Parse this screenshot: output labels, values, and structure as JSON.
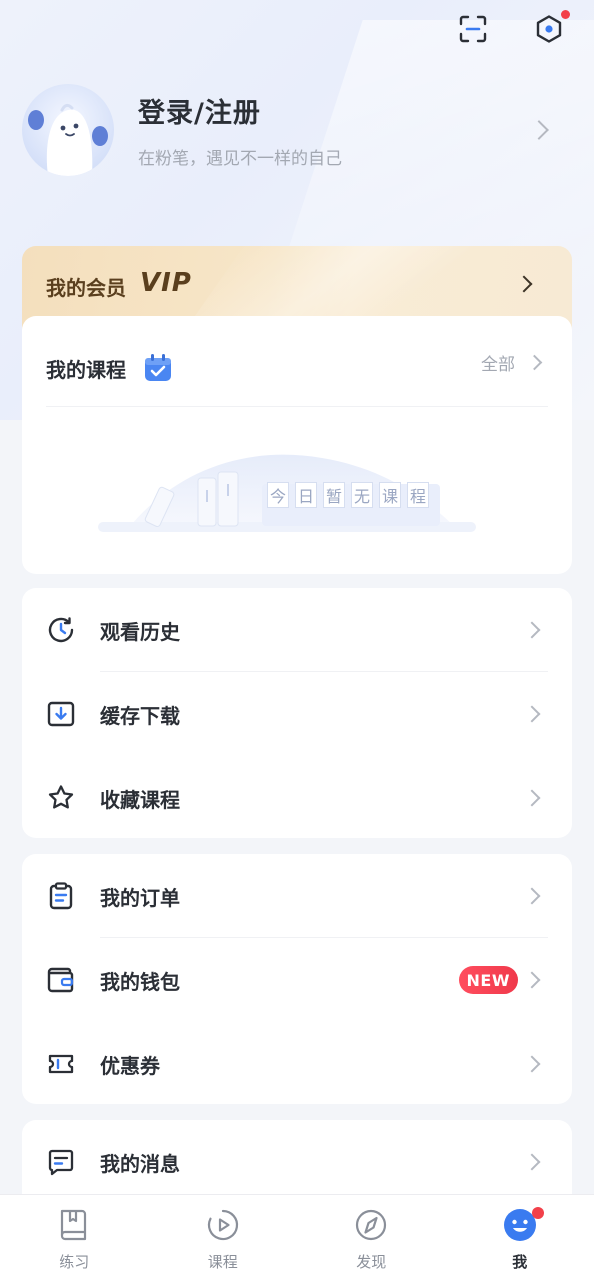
{
  "profile": {
    "title": "登录/注册",
    "subtitle": "在粉笔，遇见不一样的自己"
  },
  "vip": {
    "label": "我的会员",
    "badge": "VIP"
  },
  "courses": {
    "title": "我的课程",
    "all_label": "全部",
    "empty_chars": [
      "今",
      "日",
      "暂",
      "无",
      "课",
      "程"
    ]
  },
  "menu_group_1": [
    {
      "label": "观看历史",
      "icon": "history-icon"
    },
    {
      "label": "缓存下载",
      "icon": "download-icon"
    },
    {
      "label": "收藏课程",
      "icon": "star-icon"
    }
  ],
  "menu_group_2": [
    {
      "label": "我的订单",
      "icon": "order-icon"
    },
    {
      "label": "我的钱包",
      "icon": "wallet-icon",
      "badge": "NEW"
    },
    {
      "label": "优惠券",
      "icon": "coupon-icon"
    }
  ],
  "menu_group_3": [
    {
      "label": "我的消息",
      "icon": "message-icon"
    }
  ],
  "tabbar": [
    {
      "label": "练习",
      "icon": "practice-icon",
      "active": false
    },
    {
      "label": "课程",
      "icon": "course-play-icon",
      "active": false
    },
    {
      "label": "发现",
      "icon": "compass-icon",
      "active": false
    },
    {
      "label": "我",
      "icon": "smile-avatar-icon",
      "active": true
    }
  ],
  "colors": {
    "accent_blue": "#3a7bf0",
    "badge_red": "#f2404a",
    "vip_gold": "#f4dfbd"
  }
}
